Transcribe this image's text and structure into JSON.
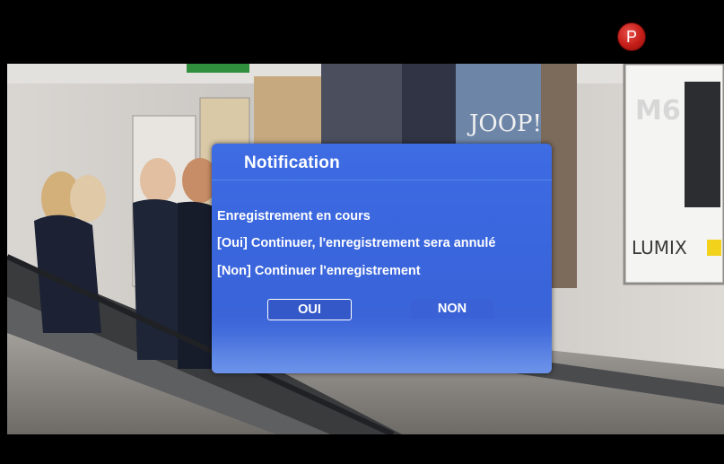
{
  "indicator": {
    "label": "P",
    "color": "#c41d18"
  },
  "video": {
    "channel_logo": "M6",
    "ad_text": "LUMIX",
    "poster_text": "JOOP!"
  },
  "dialog": {
    "title": "Notification",
    "lines": [
      "Enregistrement en cours",
      "[Oui] Continuer, l'enregistrement sera annulé",
      "[Non] Continuer l'enregistrement"
    ],
    "buttons": {
      "yes_label": "OUI",
      "no_label": "NON"
    },
    "focused_button": "OUI",
    "accent_color": "#3e6ce3"
  }
}
